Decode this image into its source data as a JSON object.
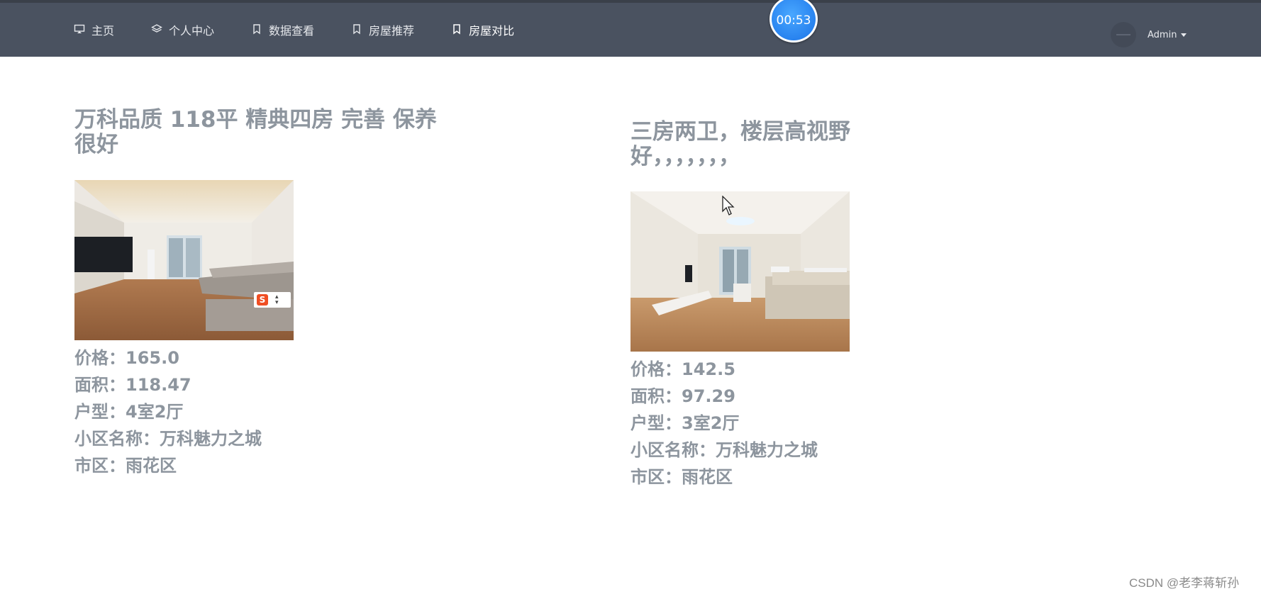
{
  "nav": {
    "items": [
      {
        "label": "主页",
        "icon": "monitor-icon"
      },
      {
        "label": "个人中心",
        "icon": "layers-icon"
      },
      {
        "label": "数据查看",
        "icon": "bookmark-icon"
      },
      {
        "label": "房屋推荐",
        "icon": "bookmark-icon"
      },
      {
        "label": "房屋对比",
        "icon": "bookmark-icon"
      }
    ]
  },
  "timer": {
    "label": "00:53"
  },
  "user": {
    "name": "Admin"
  },
  "houses": [
    {
      "title": "万科品质 118平 精典四房 完善 保养很好",
      "price_label": "价格：",
      "price": "165.0",
      "area_label": "面积：",
      "area": "118.47",
      "layout_label": "户型：",
      "layout": "4室2厅",
      "community_label": "小区名称：",
      "community": "万科魅力之城",
      "district_label": "市区：",
      "district": "雨花区"
    },
    {
      "title": "三房两卫，楼层高视野好，，，，，，，",
      "price_label": "价格：",
      "price": "142.5",
      "area_label": "面积：",
      "area": "97.29",
      "layout_label": "户型：",
      "layout": "3室2厅",
      "community_label": "小区名称：",
      "community": "万科魅力之城",
      "district_label": "市区：",
      "district": "雨花区"
    }
  ],
  "watermark": "CSDN @老李蒋斩孙"
}
